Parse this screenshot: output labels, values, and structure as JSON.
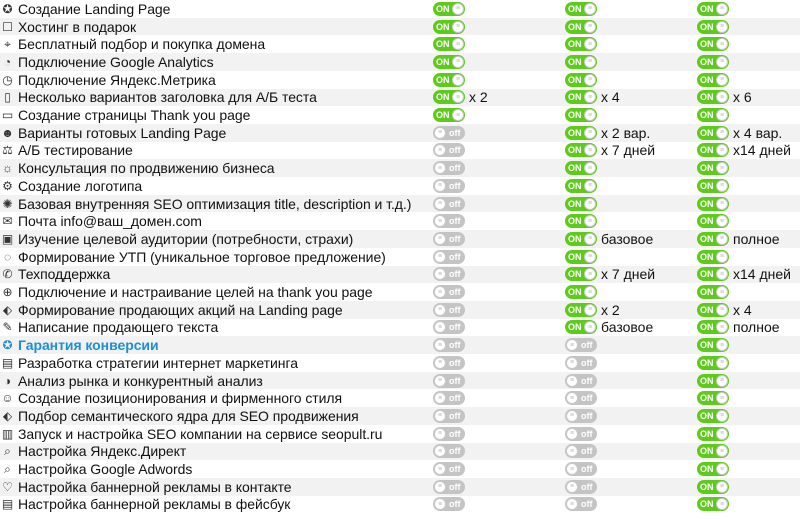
{
  "columns": [
    "tariff-1",
    "tariff-2",
    "tariff-3"
  ],
  "rows": [
    {
      "feature": "Создание Landing Page",
      "icon": "award-icon",
      "cells": [
        {
          "state": "on",
          "label": "ON"
        },
        {
          "state": "on",
          "label": "ON"
        },
        {
          "state": "on",
          "label": "ON"
        }
      ]
    },
    {
      "feature": "Хостинг в подарок",
      "icon": "hosting-icon",
      "cells": [
        {
          "state": "on",
          "label": "ON"
        },
        {
          "state": "on",
          "label": "ON"
        },
        {
          "state": "on",
          "label": "ON"
        }
      ]
    },
    {
      "feature": "Бесплатный подбор и покупка домена",
      "icon": "location-pin-icon",
      "cells": [
        {
          "state": "on",
          "label": "ON"
        },
        {
          "state": "on",
          "label": "ON"
        },
        {
          "state": "on",
          "label": "ON"
        }
      ]
    },
    {
      "feature": "Подключение Google Analytics",
      "icon": "analytics-icon",
      "cells": [
        {
          "state": "on",
          "label": "ON"
        },
        {
          "state": "on",
          "label": "ON"
        },
        {
          "state": "on",
          "label": "ON"
        }
      ]
    },
    {
      "feature": "Подключение Яндекс.Метрика",
      "icon": "gauge-icon",
      "cells": [
        {
          "state": "on",
          "label": "ON"
        },
        {
          "state": "on",
          "label": "ON"
        },
        {
          "state": "on",
          "label": "ON"
        }
      ]
    },
    {
      "feature": "Несколько вариантов заголовка для А/Б теста",
      "icon": "documents-icon",
      "cells": [
        {
          "state": "on",
          "label": "ON",
          "note": "x 2"
        },
        {
          "state": "on",
          "label": "ON",
          "note": "x 4"
        },
        {
          "state": "on",
          "label": "ON",
          "note": "x 6"
        }
      ]
    },
    {
      "feature": "Создание страницы Thank you page",
      "icon": "page-icon",
      "cells": [
        {
          "state": "on",
          "label": "ON"
        },
        {
          "state": "on",
          "label": "ON"
        },
        {
          "state": "on",
          "label": "ON"
        }
      ]
    },
    {
      "feature": "Варианты готовых Landing Page",
      "icon": "people-icon",
      "cells": [
        {
          "state": "off",
          "label": "off"
        },
        {
          "state": "on",
          "label": "ON",
          "note": "x 2 вар."
        },
        {
          "state": "on",
          "label": "ON",
          "note": "x 4 вар."
        }
      ]
    },
    {
      "feature": "А/Б тестирование",
      "icon": "scales-icon",
      "cells": [
        {
          "state": "off",
          "label": "off"
        },
        {
          "state": "on",
          "label": "ON",
          "note": "x 7 дней"
        },
        {
          "state": "on",
          "label": "ON",
          "note": "x14 дней"
        }
      ]
    },
    {
      "feature": "Консультация по продвижению бизнеса",
      "icon": "bulb-icon",
      "cells": [
        {
          "state": "off",
          "label": "off"
        },
        {
          "state": "on",
          "label": "ON"
        },
        {
          "state": "on",
          "label": "ON"
        }
      ]
    },
    {
      "feature": "Создание логотипа",
      "icon": "gear-icon",
      "cells": [
        {
          "state": "off",
          "label": "off"
        },
        {
          "state": "on",
          "label": "ON"
        },
        {
          "state": "on",
          "label": "ON"
        }
      ]
    },
    {
      "feature": "Базовая внутренняя SEO оптимизация title, description и т.д.)",
      "icon": "cog-icon",
      "cells": [
        {
          "state": "off",
          "label": "off"
        },
        {
          "state": "on",
          "label": "ON"
        },
        {
          "state": "on",
          "label": "ON"
        }
      ]
    },
    {
      "feature": "Почта info@ваш_домен.com",
      "icon": "mail-icon",
      "cells": [
        {
          "state": "off",
          "label": "off"
        },
        {
          "state": "on",
          "label": "ON"
        },
        {
          "state": "on",
          "label": "ON"
        }
      ]
    },
    {
      "feature": "Изучение целевой аудитории (потребности, страхи)",
      "icon": "id-card-icon",
      "cells": [
        {
          "state": "off",
          "label": "off"
        },
        {
          "state": "on",
          "label": "ON",
          "note": "базовое"
        },
        {
          "state": "on",
          "label": "ON",
          "note": "полное"
        }
      ]
    },
    {
      "feature": "Формирование УТП (уникальное торговое предложение)",
      "icon": "chat-icon",
      "cells": [
        {
          "state": "off",
          "label": "off"
        },
        {
          "state": "on",
          "label": "ON"
        },
        {
          "state": "on",
          "label": "ON"
        }
      ]
    },
    {
      "feature": "Техподдержка",
      "icon": "phone-icon",
      "cells": [
        {
          "state": "off",
          "label": "off"
        },
        {
          "state": "on",
          "label": "ON",
          "note": "x 7 дней"
        },
        {
          "state": "on",
          "label": "ON",
          "note": "x14 дней"
        }
      ]
    },
    {
      "feature": "Подключение и настраивание целей на thank you page",
      "icon": "target-icon",
      "cells": [
        {
          "state": "off",
          "label": "off"
        },
        {
          "state": "on",
          "label": "ON"
        },
        {
          "state": "on",
          "label": "ON"
        }
      ]
    },
    {
      "feature": "Формирование  продающих акций на Landing page",
      "icon": "tag-icon",
      "cells": [
        {
          "state": "off",
          "label": "off"
        },
        {
          "state": "on",
          "label": "ON",
          "note": "x 2"
        },
        {
          "state": "on",
          "label": "ON",
          "note": "x 4"
        }
      ]
    },
    {
      "feature": "Написание продающего текста",
      "icon": "pencil-icon",
      "cells": [
        {
          "state": "off",
          "label": "off"
        },
        {
          "state": "on",
          "label": "ON",
          "note": "базовое"
        },
        {
          "state": "on",
          "label": "ON",
          "note": "полное"
        }
      ]
    },
    {
      "feature": "Гарантия конверсии",
      "icon": "award-icon",
      "highlight": true,
      "cells": [
        {
          "state": "off",
          "label": "off"
        },
        {
          "state": "off",
          "label": "off"
        },
        {
          "state": "on",
          "label": "ON"
        }
      ]
    },
    {
      "feature": "Разработка стратегии интернет маркетинга",
      "icon": "document-icon",
      "cells": [
        {
          "state": "off",
          "label": "off"
        },
        {
          "state": "off",
          "label": "off"
        },
        {
          "state": "on",
          "label": "ON"
        }
      ]
    },
    {
      "feature": "Анализ рынка и конкурентный анализ",
      "icon": "chart-pie-icon",
      "cells": [
        {
          "state": "off",
          "label": "off"
        },
        {
          "state": "off",
          "label": "off"
        },
        {
          "state": "on",
          "label": "ON"
        }
      ]
    },
    {
      "feature": "Создание позиционирования и фирменного стиля",
      "icon": "person-icon",
      "cells": [
        {
          "state": "off",
          "label": "off"
        },
        {
          "state": "off",
          "label": "off"
        },
        {
          "state": "on",
          "label": "ON"
        }
      ]
    },
    {
      "feature": "Подбор семантического ядра для SEO продвижения",
      "icon": "tag-icon",
      "cells": [
        {
          "state": "off",
          "label": "off"
        },
        {
          "state": "off",
          "label": "off"
        },
        {
          "state": "on",
          "label": "ON"
        }
      ]
    },
    {
      "feature": "Запуск и настройка SEO компании на сервисе seopult.ru",
      "icon": "bar-chart-icon",
      "cells": [
        {
          "state": "off",
          "label": "off"
        },
        {
          "state": "off",
          "label": "off"
        },
        {
          "state": "on",
          "label": "ON"
        }
      ]
    },
    {
      "feature": "Настройка Яндекс.Директ",
      "icon": "search-icon",
      "cells": [
        {
          "state": "off",
          "label": "off"
        },
        {
          "state": "off",
          "label": "off"
        },
        {
          "state": "on",
          "label": "ON"
        }
      ]
    },
    {
      "feature": "Настройка Google Adwords",
      "icon": "search-icon",
      "cells": [
        {
          "state": "off",
          "label": "off"
        },
        {
          "state": "off",
          "label": "off"
        },
        {
          "state": "on",
          "label": "ON"
        }
      ]
    },
    {
      "feature": "Настройка баннерной рекламы в контакте",
      "icon": "heart-icon",
      "cells": [
        {
          "state": "off",
          "label": "off"
        },
        {
          "state": "off",
          "label": "off"
        },
        {
          "state": "on",
          "label": "ON"
        }
      ]
    },
    {
      "feature": "Настройка баннерной рекламы в фейсбук",
      "icon": "document-icon",
      "cells": [
        {
          "state": "off",
          "label": "off"
        },
        {
          "state": "off",
          "label": "off"
        },
        {
          "state": "on",
          "label": "ON"
        }
      ]
    }
  ],
  "colors": {
    "on": "#5ecb1c",
    "off": "#c4c4c4",
    "highlight": "#1e8fd4"
  }
}
